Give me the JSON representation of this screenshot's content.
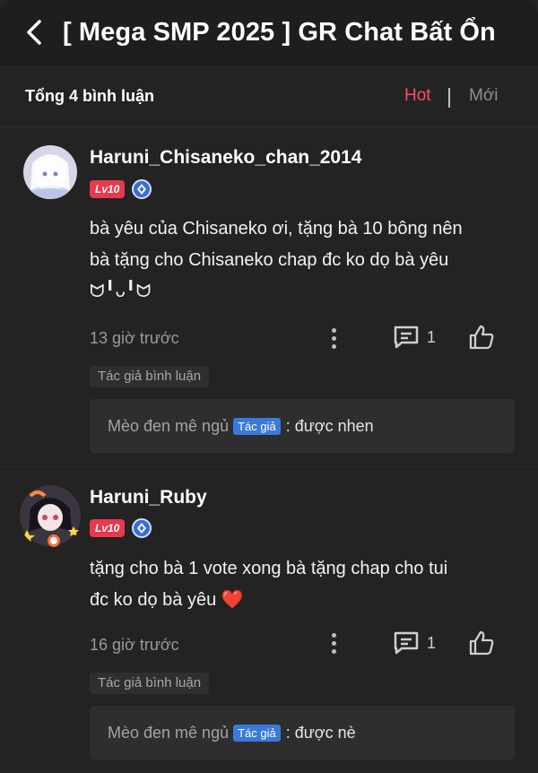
{
  "header": {
    "title": "[ Mega SMP 2025 ] GR Chat Bất Ổn",
    "back_icon": "chevron-left-icon"
  },
  "sortbar": {
    "total": "Tổng 4 bình luận",
    "hot": "Hot",
    "new": "Mới",
    "active_color": "#ff4d6d"
  },
  "comments": [
    {
      "username": "Haruni_Chisaneko_chan_2014",
      "level": "Lv10",
      "text_line1": "bà yêu của Chisaneko ơi, tặng bà 10 bông nên",
      "text_line2": "bà tặng cho Chisaneko chap đc ko dọ bà yêu",
      "text_line3": "ᗢ╹ᴗ╹ᗢ",
      "time": "13 giờ trước",
      "reply_count": "1",
      "author_tag": "Tác giả bình luận",
      "reply": {
        "name": "Mèo đen mê ngủ",
        "tag": "Tác giả",
        "text": ": được nhen"
      }
    },
    {
      "username": "Haruni_Ruby",
      "level": "Lv10",
      "text_line1": "tặng cho bà 1 vote xong bà tặng chap cho tui",
      "text_line2": "đc ko dọ bà yêu",
      "heart": "❤️",
      "time": "16 giờ trước",
      "reply_count": "1",
      "author_tag": "Tác giả bình luận",
      "reply": {
        "name": "Mèo đen mê ngủ",
        "tag": "Tác giả",
        "text": ": được nè"
      }
    }
  ],
  "colors": {
    "background": "#232323",
    "level_badge": "#e8394d",
    "author_tag": "#3a7ad9"
  }
}
